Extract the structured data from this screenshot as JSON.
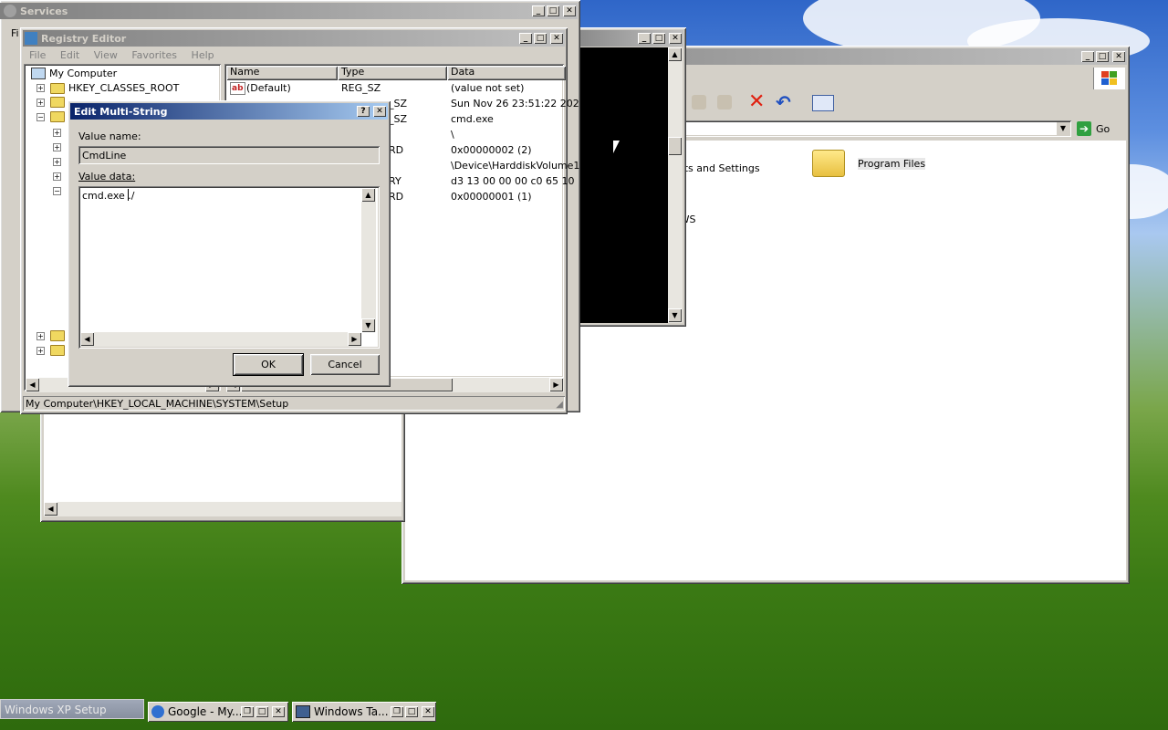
{
  "services_window": {
    "title": "Services",
    "menu_first": "Fi"
  },
  "registry_editor": {
    "title": "Registry Editor",
    "menu": [
      "File",
      "Edit",
      "View",
      "Favorites",
      "Help"
    ],
    "tree": {
      "root": "My Computer",
      "items": [
        "HKEY_CLASSES_ROOT"
      ]
    },
    "columns": [
      "Name",
      "Type",
      "Data"
    ],
    "rows": [
      {
        "name": "(Default)",
        "type": "REG_SZ",
        "data": "(value not set)"
      },
      {
        "name": "",
        "type": "_SZ",
        "data": "Sun Nov 26 23:51:22 202"
      },
      {
        "name": "",
        "type": "_SZ",
        "data": "cmd.exe"
      },
      {
        "name": "",
        "type": "",
        "data": "\\"
      },
      {
        "name": "",
        "type": "RD",
        "data": "0x00000002 (2)"
      },
      {
        "name": "",
        "type": "",
        "data": "\\Device\\HarddiskVolume1"
      },
      {
        "name": "",
        "type": "RY",
        "data": "d3 13 00 00 00 c0 65 10"
      },
      {
        "name": "",
        "type": "RD",
        "data": "0x00000001 (1)"
      }
    ],
    "status": "My Computer\\HKEY_LOCAL_MACHINE\\SYSTEM\\Setup"
  },
  "dialog": {
    "title": "Edit Multi-String",
    "help": "?",
    "value_name_label": "Value name:",
    "value_name": "CmdLine",
    "value_data_label": "Value data:",
    "value_data": "cmd.exe ./",
    "ok": "OK",
    "cancel": "Cancel"
  },
  "explorer": {
    "go": "Go",
    "items": [
      {
        "label": "ents and Settings"
      },
      {
        "label": "Program Files"
      },
      {
        "label": "OWS"
      }
    ]
  },
  "taskbar": {
    "setup_label": "Windows XP Setup",
    "tasks": [
      {
        "label": "Google - My..."
      },
      {
        "label": "Windows Ta..."
      }
    ]
  },
  "colors": {
    "title_active": "#0a246a",
    "title_inactive": "#808080",
    "face": "#d4d0c8"
  }
}
